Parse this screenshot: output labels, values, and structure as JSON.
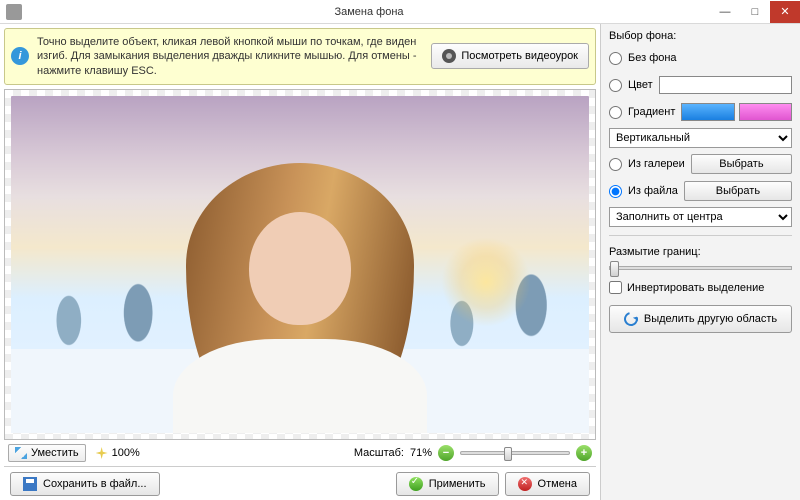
{
  "title": "Замена фона",
  "hint": "Точно выделите объект, кликая левой кнопкой мыши по точкам, где виден изгиб. Для замыкания выделения дважды кликните мышью. Для отмены - нажмите клавишу ESC.",
  "videoBtn": "Посмотреть видеоурок",
  "toolbar": {
    "fit": "Уместить",
    "zoom": "100%",
    "scaleLabel": "Масштаб:",
    "scaleValue": "71%"
  },
  "footer": {
    "save": "Сохранить в файл...",
    "apply": "Применить",
    "cancel": "Отмена"
  },
  "panel": {
    "bgTitle": "Выбор фона:",
    "none": "Без фона",
    "color": "Цвет",
    "gradient": "Градиент",
    "gradDir": "Вертикальный",
    "fromGallery": "Из галереи",
    "fromFile": "Из файла",
    "choose": "Выбрать",
    "fillMode": "Заполнить от центра",
    "blurTitle": "Размытие границ:",
    "invert": "Инвертировать выделение",
    "reselect": "Выделить другую область"
  }
}
